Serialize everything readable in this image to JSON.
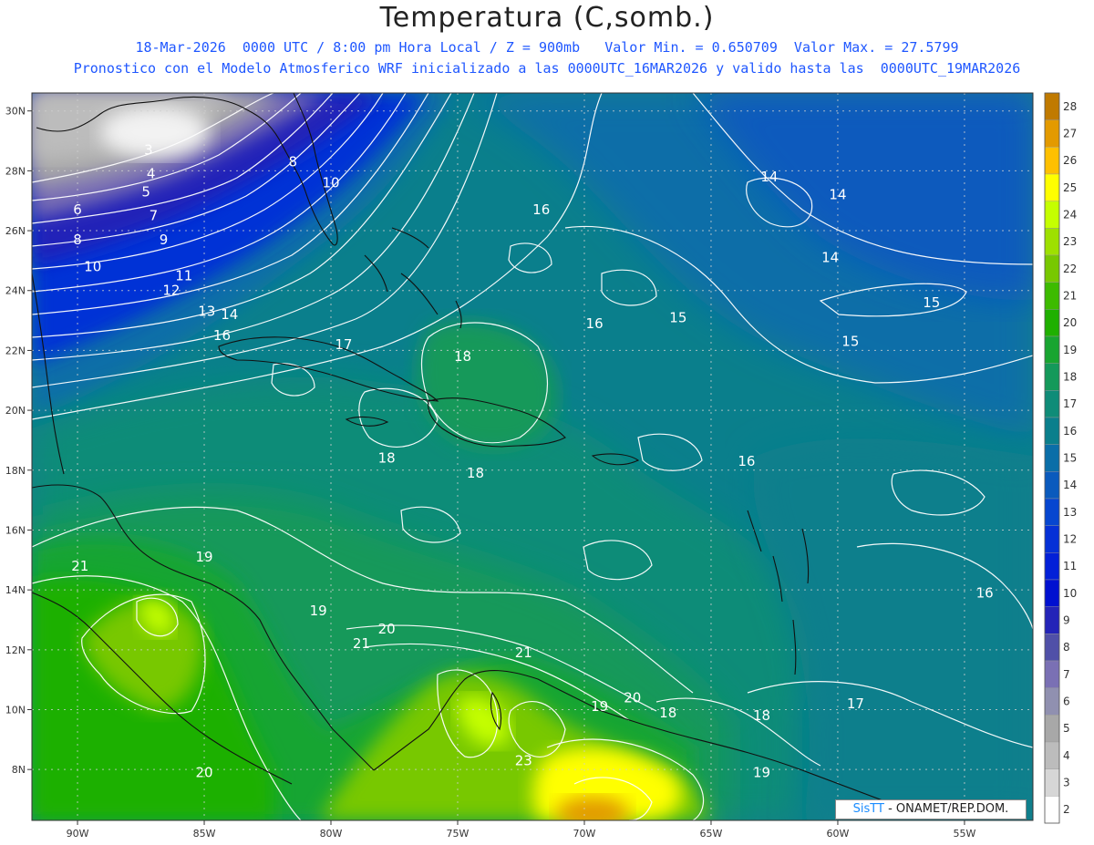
{
  "header": {
    "title": "Temperatura (C,somb.)",
    "line1": "18-Mar-2026  0000 UTC / 8:00 pm Hora Local / Z = 900mb   Valor Min. = 0.650709  Valor Max. = 27.5799",
    "line2": "Pronostico con el Modelo Atmosferico WRF inicializado a las 0000UTC_16MAR2026 y valido hasta las  0000UTC_19MAR2026"
  },
  "map": {
    "lat_labels": [
      "30N",
      "28N",
      "26N",
      "24N",
      "22N",
      "20N",
      "18N",
      "16N",
      "14N",
      "12N",
      "10N",
      "8N"
    ],
    "lon_labels": [
      "90W",
      "85W",
      "80W",
      "75W",
      "70W",
      "65W",
      "60W",
      "55W"
    ],
    "contour_labels": [
      {
        "text": "3",
        "lon": -87.2,
        "lat": 28.7
      },
      {
        "text": "4",
        "lon": -87.1,
        "lat": 27.9
      },
      {
        "text": "5",
        "lon": -87.3,
        "lat": 27.3
      },
      {
        "text": "6",
        "lon": -90.0,
        "lat": 26.7
      },
      {
        "text": "7",
        "lon": -87.0,
        "lat": 26.5
      },
      {
        "text": "8",
        "lon": -90.0,
        "lat": 25.7
      },
      {
        "text": "9",
        "lon": -86.6,
        "lat": 25.7
      },
      {
        "text": "10",
        "lon": -89.4,
        "lat": 24.8
      },
      {
        "text": "11",
        "lon": -85.8,
        "lat": 24.5
      },
      {
        "text": "12",
        "lon": -86.3,
        "lat": 24.0
      },
      {
        "text": "13",
        "lon": -84.9,
        "lat": 23.3
      },
      {
        "text": "14",
        "lon": -84.0,
        "lat": 23.2
      },
      {
        "text": "16",
        "lon": -84.3,
        "lat": 22.5
      },
      {
        "text": "17",
        "lon": -79.5,
        "lat": 22.2
      },
      {
        "text": "8",
        "lon": -81.5,
        "lat": 28.3
      },
      {
        "text": "10",
        "lon": -80.0,
        "lat": 27.6
      },
      {
        "text": "16",
        "lon": -71.7,
        "lat": 26.7
      },
      {
        "text": "14",
        "lon": -62.7,
        "lat": 27.8
      },
      {
        "text": "14",
        "lon": -60.0,
        "lat": 27.2
      },
      {
        "text": "14",
        "lon": -60.3,
        "lat": 25.1
      },
      {
        "text": "15",
        "lon": -66.3,
        "lat": 23.1
      },
      {
        "text": "15",
        "lon": -56.3,
        "lat": 23.6
      },
      {
        "text": "15",
        "lon": -59.5,
        "lat": 22.3
      },
      {
        "text": "16",
        "lon": -69.6,
        "lat": 22.9
      },
      {
        "text": "18",
        "lon": -74.8,
        "lat": 21.8
      },
      {
        "text": "18",
        "lon": -77.8,
        "lat": 18.4
      },
      {
        "text": "18",
        "lon": -74.3,
        "lat": 17.9
      },
      {
        "text": "16",
        "lon": -63.6,
        "lat": 18.3
      },
      {
        "text": "19",
        "lon": -85.0,
        "lat": 15.1
      },
      {
        "text": "21",
        "lon": -89.9,
        "lat": 14.8
      },
      {
        "text": "19",
        "lon": -80.5,
        "lat": 13.3
      },
      {
        "text": "20",
        "lon": -77.8,
        "lat": 12.7
      },
      {
        "text": "21",
        "lon": -78.8,
        "lat": 12.2
      },
      {
        "text": "21",
        "lon": -72.4,
        "lat": 11.9
      },
      {
        "text": "20",
        "lon": -68.1,
        "lat": 10.4
      },
      {
        "text": "19",
        "lon": -69.4,
        "lat": 10.1
      },
      {
        "text": "18",
        "lon": -66.7,
        "lat": 9.9
      },
      {
        "text": "18",
        "lon": -63.0,
        "lat": 9.8
      },
      {
        "text": "17",
        "lon": -59.3,
        "lat": 10.2
      },
      {
        "text": "16",
        "lon": -54.2,
        "lat": 13.9
      },
      {
        "text": "19",
        "lon": -63.0,
        "lat": 7.9
      },
      {
        "text": "20",
        "lon": -85.0,
        "lat": 7.9
      },
      {
        "text": "23",
        "lon": -72.4,
        "lat": 8.3
      }
    ]
  },
  "colorbar": {
    "labels": [
      "28",
      "27",
      "26",
      "25",
      "24",
      "23",
      "22",
      "21",
      "20",
      "19",
      "18",
      "17",
      "16",
      "15",
      "14",
      "13",
      "12",
      "11",
      "10",
      "9",
      "8",
      "7",
      "6",
      "5",
      "4",
      "3",
      "2"
    ],
    "colors": [
      "#c07a00",
      "#e39a00",
      "#ffc000",
      "#ffff00",
      "#c5ff00",
      "#9ee000",
      "#78c800",
      "#3dbb00",
      "#1fb000",
      "#18a530",
      "#14995a",
      "#0f8c78",
      "#0a7f8c",
      "#0a6ea8",
      "#0a5abd",
      "#0646d0",
      "#0530d6",
      "#0320d8",
      "#0010d0",
      "#2424b8",
      "#5050a8",
      "#7a70b4",
      "#9090b0",
      "#a8a8a8",
      "#bcbcbc",
      "#d6d6d6",
      "#ffffff"
    ]
  },
  "credit": {
    "brand": "SisTT",
    "text": " - ONAMET/REP.DOM."
  }
}
